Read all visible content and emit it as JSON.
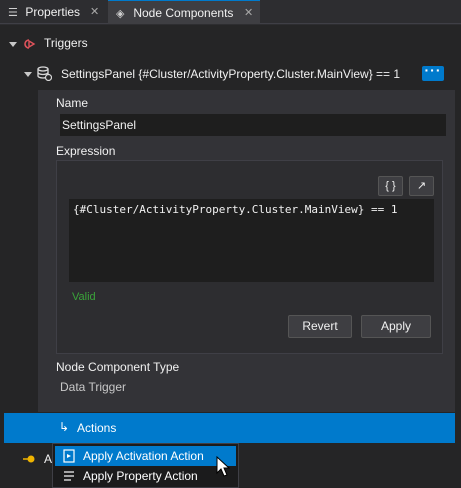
{
  "tabs": [
    {
      "label": "Properties",
      "icon": "list-icon",
      "close": "✕"
    },
    {
      "label": "Node Components",
      "icon": "component-icon",
      "close": "✕"
    }
  ],
  "tree": {
    "triggers_label": "Triggers",
    "node_label": "SettingsPanel {#Cluster/ActivityProperty.Cluster.MainView} == 1",
    "more_button": "···"
  },
  "details": {
    "name_label": "Name",
    "name_value": "SettingsPanel",
    "expression_label": "Expression",
    "braces_button": "{ }",
    "expand_button": "↗",
    "expression_value": "{#Cluster/ActivityProperty.Cluster.MainView} == 1",
    "status": "Valid",
    "revert_button": "Revert",
    "apply_button": "Apply",
    "component_type_label": "Node Component Type",
    "component_type_value": "Data Trigger"
  },
  "actions": {
    "label": "Actions"
  },
  "bottom_row_label": "A",
  "context_menu": [
    {
      "label": "Apply Activation Action",
      "highlighted": true
    },
    {
      "label": "Apply Property Action",
      "highlighted": false
    }
  ],
  "colors": {
    "accent": "#007acc",
    "valid": "#3aa33a",
    "trigger_icon": "#e0535b",
    "bottom_icon": "#f0b400"
  }
}
